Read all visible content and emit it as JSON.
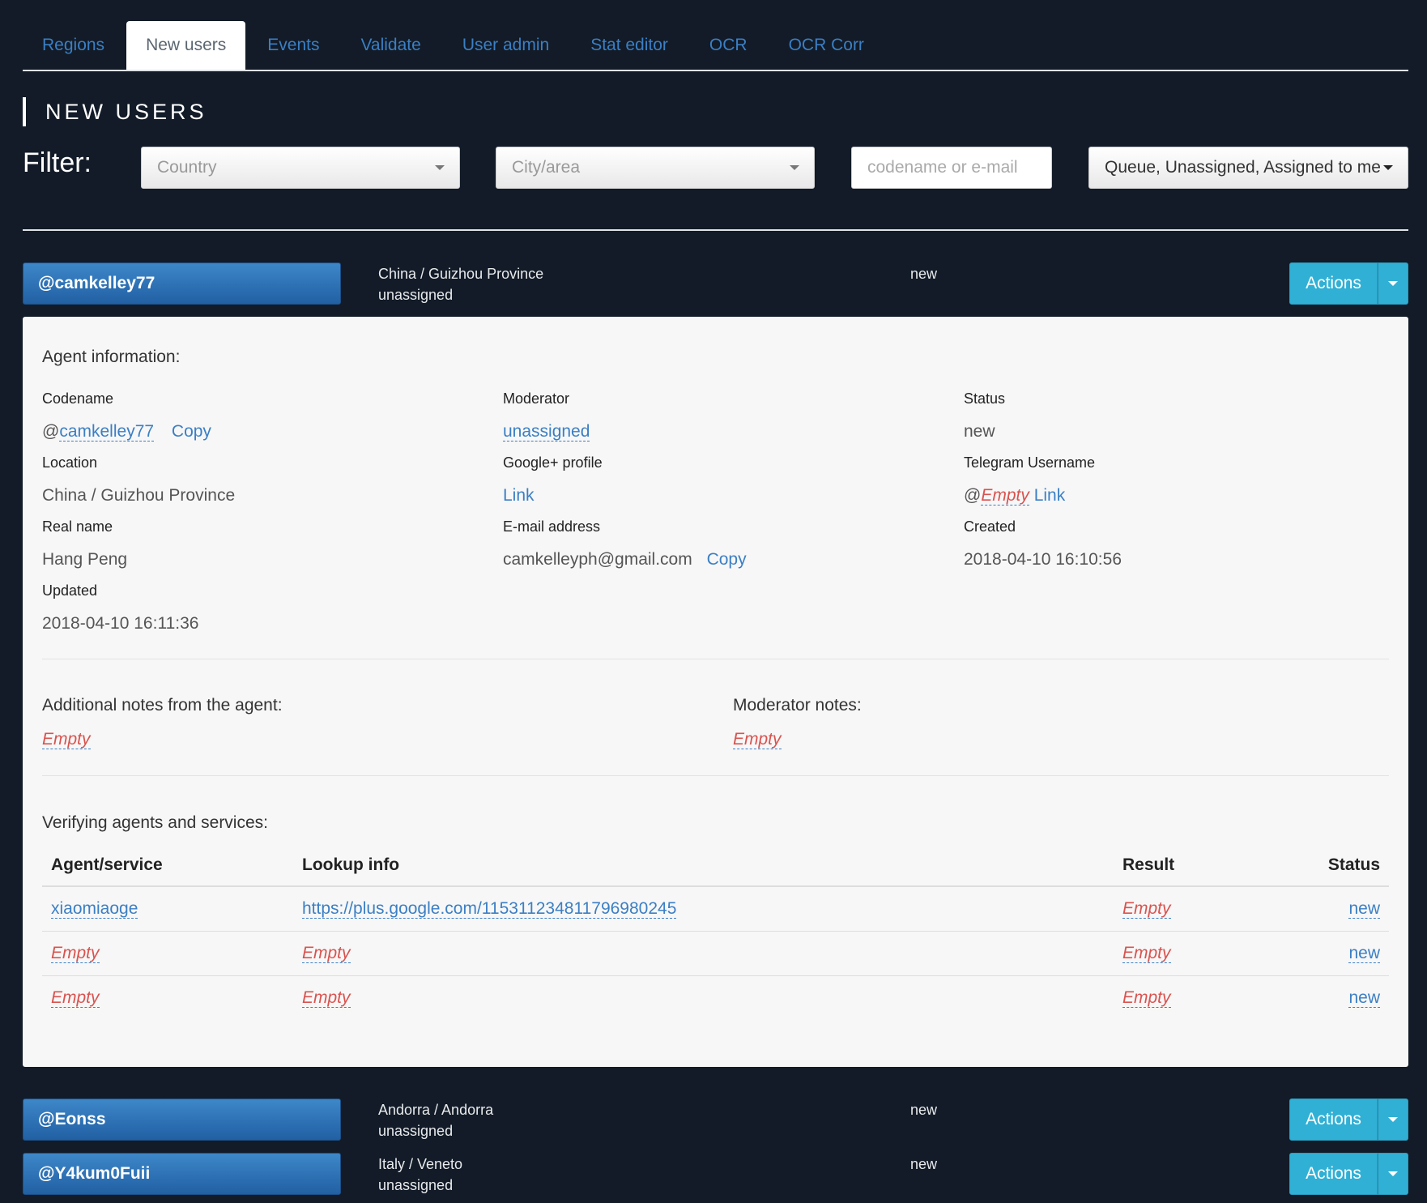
{
  "tabs": [
    "Regions",
    "New users",
    "Events",
    "Validate",
    "User admin",
    "Stat editor",
    "OCR",
    "OCR Corr"
  ],
  "active_tab": 1,
  "section_title": "NEW USERS",
  "filter": {
    "label": "Filter:",
    "country": "Country",
    "city": "City/area",
    "search_placeholder": "codename or e-mail",
    "queue": "Queue, Unassigned, Assigned to me"
  },
  "users": [
    {
      "codename": "@camkelley77",
      "location": "China / Guizhou Province",
      "assignee": "unassigned",
      "status": "new",
      "actions": "Actions"
    },
    {
      "codename": "@Eonss",
      "location": "Andorra / Andorra",
      "assignee": "unassigned",
      "status": "new",
      "actions": "Actions"
    },
    {
      "codename": "@Y4kum0Fuii",
      "location": "Italy / Veneto",
      "assignee": "unassigned",
      "status": "new",
      "actions": "Actions"
    }
  ],
  "detail": {
    "heading": "Agent information:",
    "labels": {
      "codename": "Codename",
      "moderator": "Moderator",
      "status": "Status",
      "location": "Location",
      "gplus": "Google+ profile",
      "telegram": "Telegram Username",
      "realname": "Real name",
      "email": "E-mail address",
      "created": "Created",
      "updated": "Updated"
    },
    "codename_prefix": "@",
    "codename": "camkelley77",
    "copy": "Copy",
    "moderator": "unassigned",
    "status": "new",
    "location": "China / Guizhou Province",
    "gplus_link": "Link",
    "telegram_prefix": "@",
    "telegram_empty": "Empty",
    "telegram_link": "Link",
    "realname": "Hang Peng",
    "email": "camkelleyph@gmail.com",
    "created": "2018-04-10 16:10:56",
    "updated": "2018-04-10 16:11:36",
    "agent_notes_label": "Additional notes from the agent:",
    "agent_notes": "Empty",
    "mod_notes_label": "Moderator notes:",
    "mod_notes": "Empty",
    "verify_label": "Verifying agents and services:",
    "table_headers": [
      "Agent/service",
      "Lookup info",
      "Result",
      "Status"
    ],
    "rows": [
      [
        "xiaomiaoge",
        "https://plus.google.com/115311234811796980245",
        "Empty",
        "new"
      ],
      [
        "Empty",
        "Empty",
        "Empty",
        "new"
      ],
      [
        "Empty",
        "Empty",
        "Empty",
        "new"
      ]
    ]
  }
}
